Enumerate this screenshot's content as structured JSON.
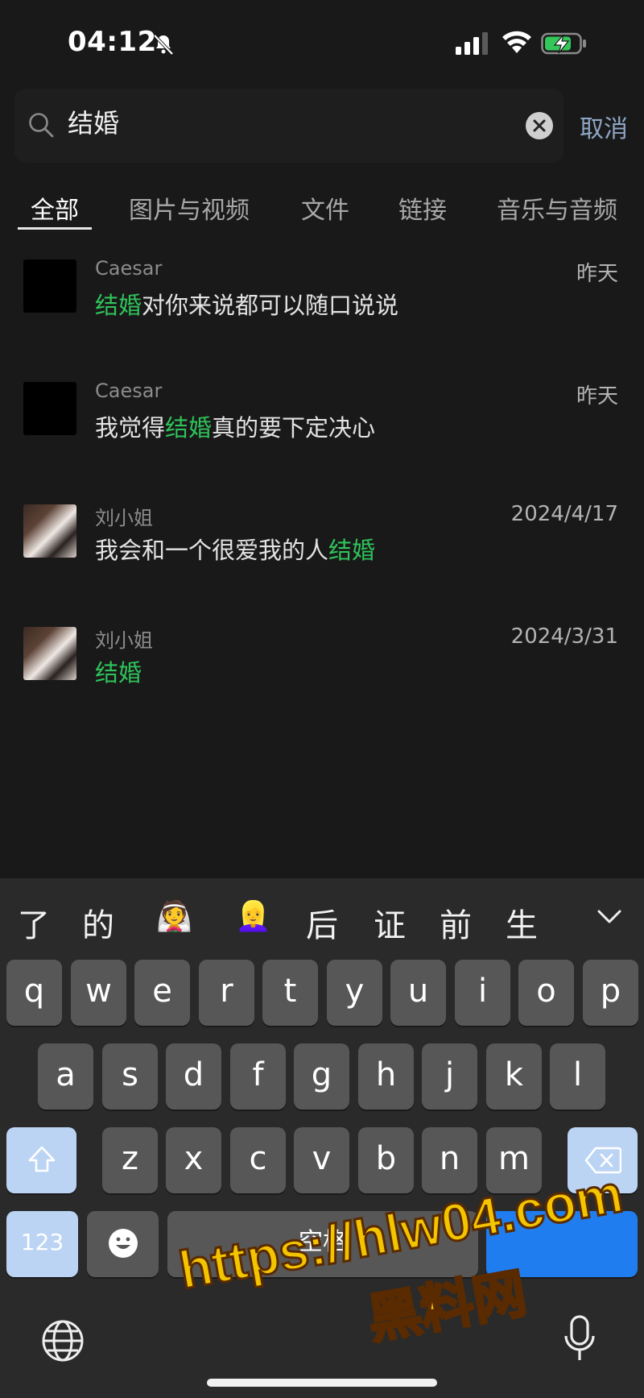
{
  "status_bar": {
    "time": "04:12"
  },
  "search": {
    "query": "结婚",
    "cancel_label": "取消"
  },
  "tabs": [
    {
      "label": "全部",
      "active": true
    },
    {
      "label": "图片与视频",
      "active": false
    },
    {
      "label": "文件",
      "active": false
    },
    {
      "label": "链接",
      "active": false
    },
    {
      "label": "音乐与音频",
      "active": false
    }
  ],
  "results": [
    {
      "name": "Caesar",
      "date": "昨天",
      "pre": "",
      "hl": "结婚",
      "post": "对你来说都可以随口说说",
      "avatar": "black"
    },
    {
      "name": "Caesar",
      "date": "昨天",
      "pre": "我觉得",
      "hl": "结婚",
      "post": "真的要下定决心",
      "avatar": "black"
    },
    {
      "name": "刘小姐",
      "date": "2024/4/17",
      "pre": "我会和一个很爱我的人",
      "hl": "结婚",
      "post": "",
      "avatar": "photo"
    },
    {
      "name": "刘小姐",
      "date": "2024/3/31",
      "pre": "",
      "hl": "结婚",
      "post": "",
      "avatar": "photo"
    }
  ],
  "keyboard": {
    "candidates": [
      "了",
      "的",
      "👰",
      "👱‍♀️",
      "后",
      "证",
      "前",
      "生"
    ],
    "row1": [
      "q",
      "w",
      "e",
      "r",
      "t",
      "y",
      "u",
      "i",
      "o",
      "p"
    ],
    "row2": [
      "a",
      "s",
      "d",
      "f",
      "g",
      "h",
      "j",
      "k",
      "l"
    ],
    "row3": [
      "z",
      "x",
      "c",
      "v",
      "b",
      "n",
      "m"
    ],
    "num_label": "123",
    "space_label": "空格"
  },
  "watermark": {
    "line1": "https://hlw04.com",
    "line2": "黑料网"
  },
  "colors": {
    "highlight": "#2fc35a",
    "cancel": "#8fa6c4",
    "send_key": "#1f7df0"
  },
  "icons": [
    "bell-slash-icon",
    "signal-icon",
    "wifi-icon",
    "battery-charging-icon",
    "search-icon",
    "clear-icon",
    "chevron-down-icon",
    "shift-icon",
    "backspace-icon",
    "emoji-icon",
    "globe-icon",
    "microphone-icon"
  ]
}
